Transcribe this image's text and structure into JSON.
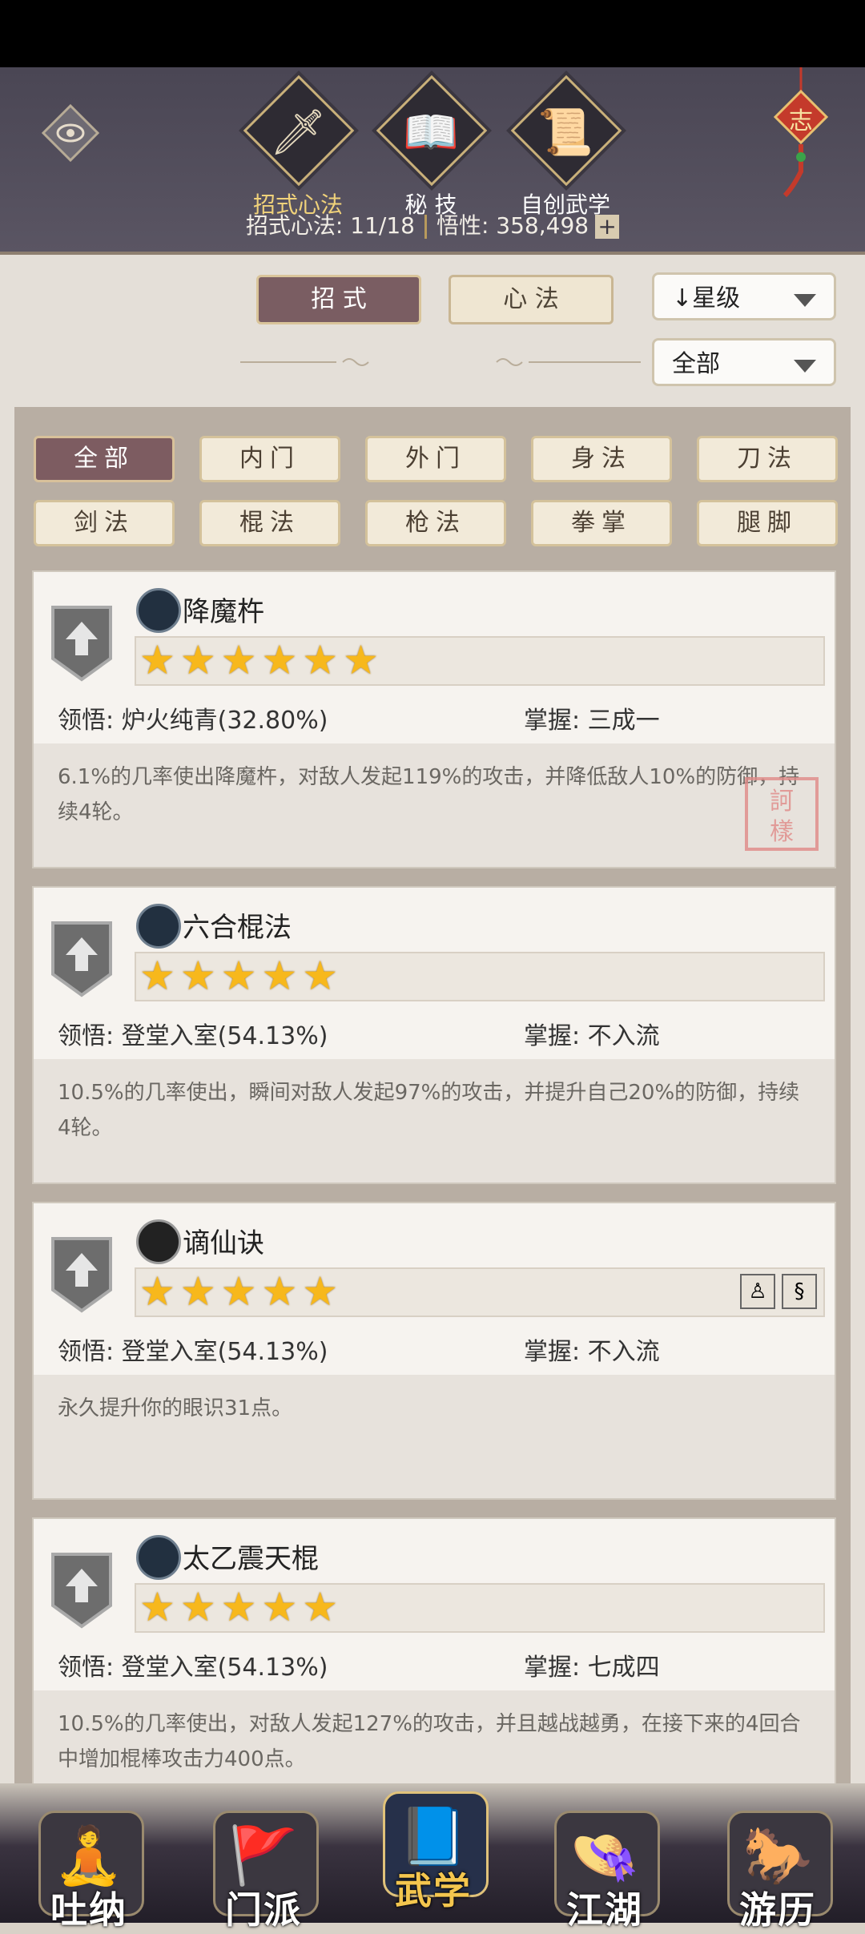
{
  "header": {
    "tabs": [
      {
        "label": "招式心法",
        "icon": "sword-icon",
        "active": true
      },
      {
        "label": "秘 技",
        "icon": "book-icon",
        "active": false
      },
      {
        "label": "自创武学",
        "icon": "scroll-icon",
        "active": false
      }
    ],
    "stats": {
      "count_label": "招式心法: 11/18",
      "wisdom_label": "悟性: 358,498"
    },
    "knot_char": "志"
  },
  "mode_tabs": [
    {
      "label": "招 式",
      "active": true
    },
    {
      "label": "心 法",
      "active": false
    }
  ],
  "sort_select": {
    "value": "星级"
  },
  "scope_select": {
    "value": "全部"
  },
  "filters": [
    {
      "label": "全部",
      "active": true
    },
    {
      "label": "内门",
      "active": false
    },
    {
      "label": "外门",
      "active": false
    },
    {
      "label": "身法",
      "active": false
    },
    {
      "label": "刀法",
      "active": false
    },
    {
      "label": "剑法",
      "active": false
    },
    {
      "label": "棍法",
      "active": false
    },
    {
      "label": "枪法",
      "active": false
    },
    {
      "label": "拳掌",
      "active": false
    },
    {
      "label": "腿脚",
      "active": false
    }
  ],
  "skills": [
    {
      "name": "降魔杵",
      "type_icon": "staff-icon",
      "stars": 6,
      "comprehension": "领悟: 炉火纯青(32.80%)",
      "mastery": "掌握: 三成一",
      "description": "6.1%的几率使出降魔杵，对敌人发起119%的攻击，并降低敌人10%的防御，持续4轮。"
    },
    {
      "name": "六合棍法",
      "type_icon": "staff-icon",
      "stars": 5,
      "comprehension": "领悟: 登堂入室(54.13%)",
      "mastery": "掌握: 不入流",
      "description": "10.5%的几率使出，瞬间对敌人发起97%的攻击，并提升自己20%的防御，持续4轮。"
    },
    {
      "name": "谪仙诀",
      "type_icon": "yin-yang-icon",
      "stars": 5,
      "comprehension": "领悟: 登堂入室(54.13%)",
      "mastery": "掌握: 不入流",
      "description": "永久提升你的眼识31点。"
    },
    {
      "name": "太乙震天棍",
      "type_icon": "staff-icon",
      "stars": 5,
      "comprehension": "领悟: 登堂入室(54.13%)",
      "mastery": "掌握: 七成四",
      "description": "10.5%的几率使出，对敌人发起127%的攻击，并且越战越勇，在接下来的4回合中增加棍棒攻击力400点。"
    }
  ],
  "bottom_nav": [
    {
      "label": "吐纳",
      "active": false
    },
    {
      "label": "门派",
      "active": false
    },
    {
      "label": "武学",
      "active": true
    },
    {
      "label": "江湖",
      "active": false
    },
    {
      "label": "游历",
      "active": false
    }
  ]
}
